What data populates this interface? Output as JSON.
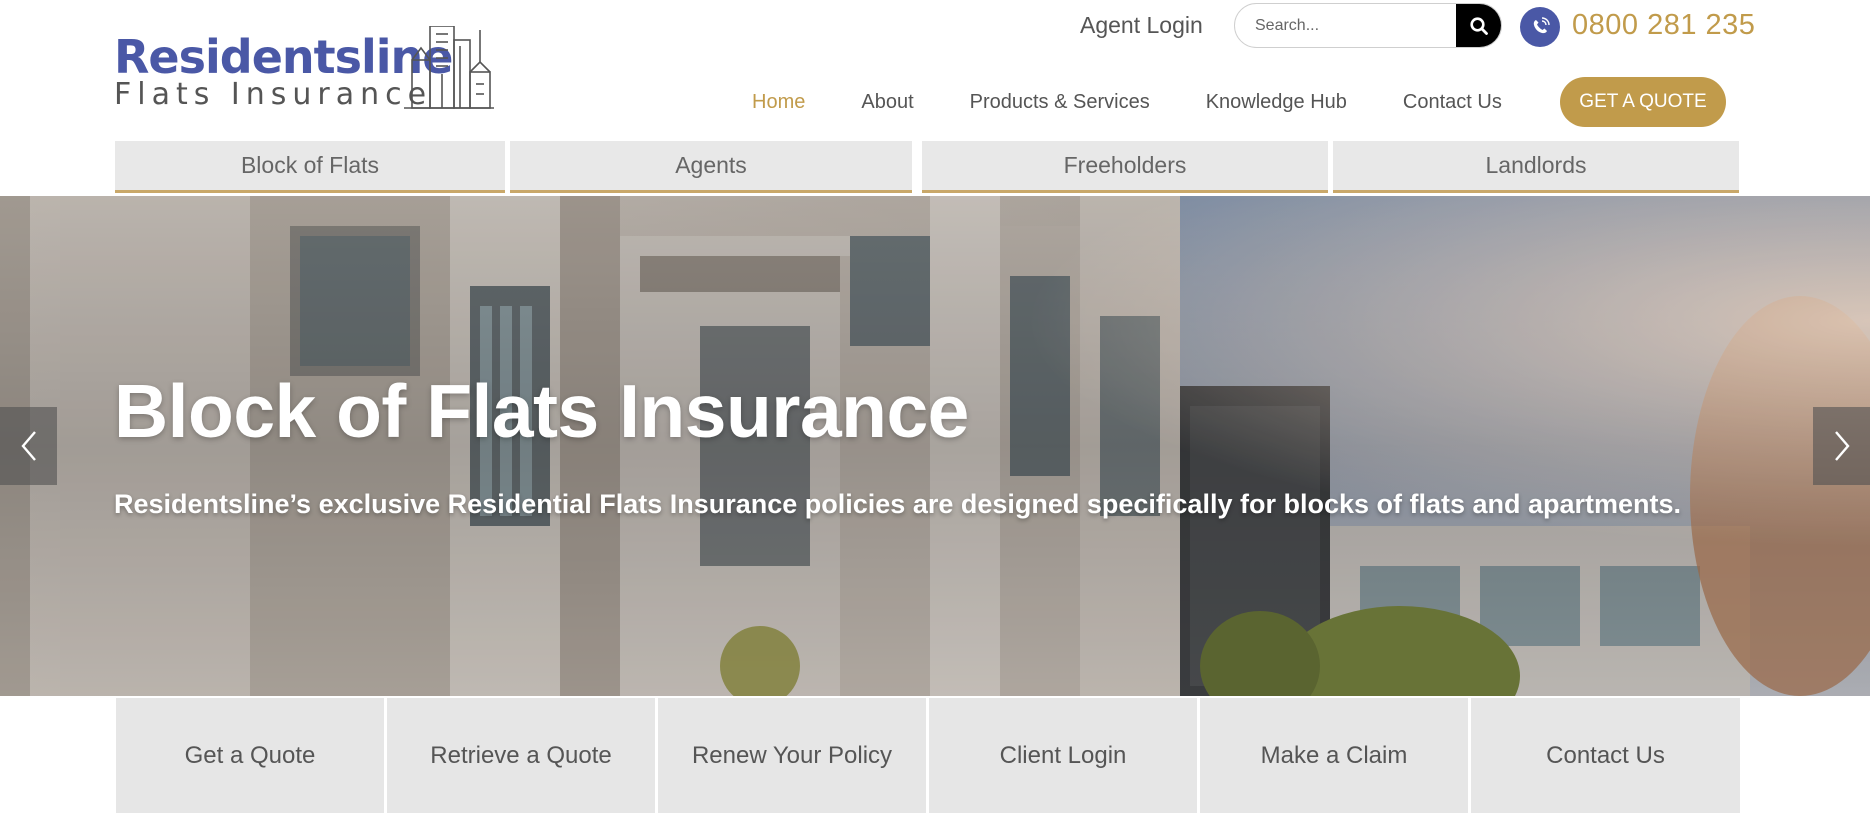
{
  "brand": {
    "name_line1": "Residentsline",
    "name_line2": "Flats Insurance",
    "primary_color": "#4a58a6",
    "accent_color": "#c19b4b"
  },
  "topbar": {
    "agent_login": "Agent Login",
    "search_placeholder": "Search...",
    "search_icon": "search-icon",
    "phone_icon": "phone-icon",
    "phone_number": "0800 281 235"
  },
  "nav": {
    "items": [
      {
        "label": "Home",
        "active": true
      },
      {
        "label": "About",
        "active": false
      },
      {
        "label": "Products & Services",
        "active": false
      },
      {
        "label": "Knowledge Hub",
        "active": false
      },
      {
        "label": "Contact Us",
        "active": false
      }
    ],
    "cta": "GET A QUOTE"
  },
  "subtabs": [
    {
      "label": "Block of Flats"
    },
    {
      "label": "Agents"
    },
    {
      "label": "Freeholders"
    },
    {
      "label": "Landlords"
    }
  ],
  "hero": {
    "title": "Block of Flats Insurance",
    "subtitle": "Residentsline’s exclusive Residential Flats Insurance policies are designed specifically for blocks of flats and apartments.",
    "prev_icon": "chevron-left-icon",
    "next_icon": "chevron-right-icon"
  },
  "tiles": [
    {
      "label": "Get a Quote"
    },
    {
      "label": "Retrieve a Quote"
    },
    {
      "label": "Renew Your Policy"
    },
    {
      "label": "Client Login"
    },
    {
      "label": "Make a Claim"
    },
    {
      "label": "Contact Us"
    }
  ]
}
